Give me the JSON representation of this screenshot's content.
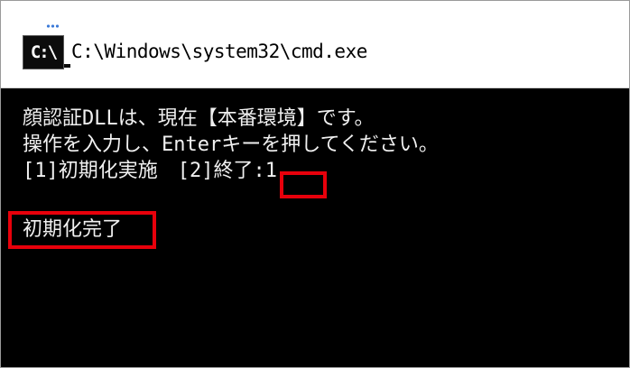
{
  "window": {
    "title": "C:\\Windows\\system32\\cmd.exe",
    "icon_text": "C:\\",
    "icon": "console-icon"
  },
  "console": {
    "lines": [
      "顔認証DLLは、現在【本番環境】です。",
      "操作を入力し、Enterキーを押してください。",
      "[1]初期化実施　[2]終了",
      "初期化完了"
    ],
    "input_prompt": ":1"
  },
  "colors": {
    "background": "#000000",
    "text": "#f0f0f0",
    "highlight": "#e8000b"
  }
}
